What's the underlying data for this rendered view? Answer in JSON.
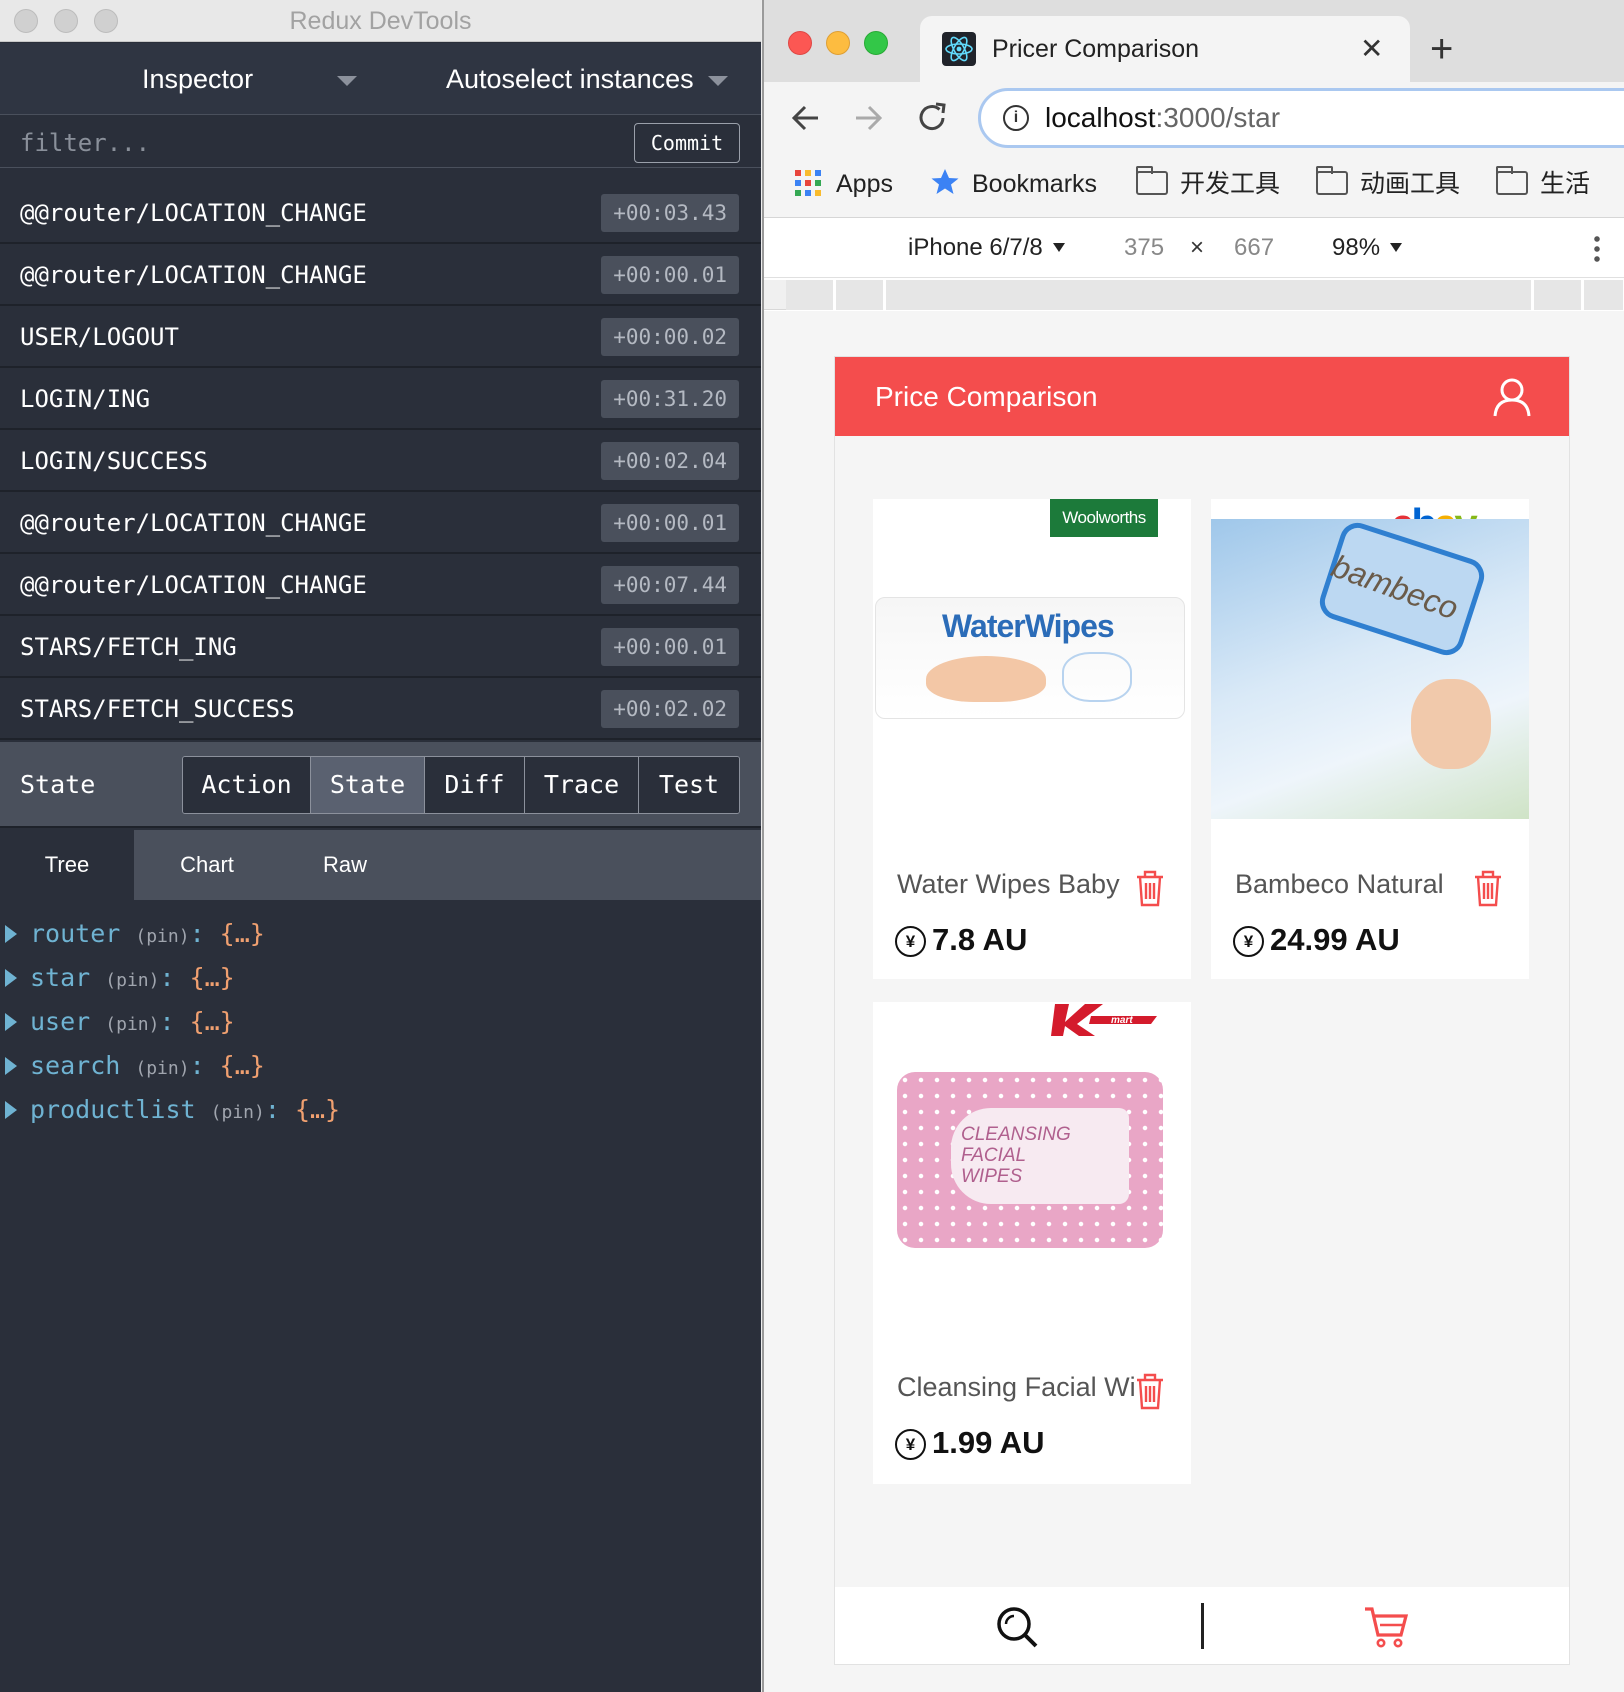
{
  "devtools": {
    "window_title": "Redux DevTools",
    "monitor_label": "Inspector",
    "instances_label": "Autoselect instances",
    "filter_placeholder": "filter...",
    "commit_label": "Commit",
    "actions": [
      {
        "name": "@@router/LOCATION_CHANGE",
        "time": "+00:03.43"
      },
      {
        "name": "@@router/LOCATION_CHANGE",
        "time": "+00:00.01"
      },
      {
        "name": "USER/LOGOUT",
        "time": "+00:00.02"
      },
      {
        "name": "LOGIN/ING",
        "time": "+00:31.20"
      },
      {
        "name": "LOGIN/SUCCESS",
        "time": "+00:02.04"
      },
      {
        "name": "@@router/LOCATION_CHANGE",
        "time": "+00:00.01"
      },
      {
        "name": "@@router/LOCATION_CHANGE",
        "time": "+00:07.44"
      },
      {
        "name": "STARS/FETCH_ING",
        "time": "+00:00.01"
      },
      {
        "name": "STARS/FETCH_SUCCESS",
        "time": "+00:02.02"
      }
    ],
    "state_bar_title": "State",
    "tabs": [
      "Action",
      "State",
      "Diff",
      "Trace",
      "Test"
    ],
    "active_tab": "State",
    "subtabs": [
      "Tree",
      "Chart",
      "Raw"
    ],
    "active_subtab": "Tree",
    "tree": [
      {
        "key": "router",
        "pin": "(pin)",
        "value": "{…}"
      },
      {
        "key": "star",
        "pin": "(pin)",
        "value": "{…}"
      },
      {
        "key": "user",
        "pin": "(pin)",
        "value": "{…}"
      },
      {
        "key": "search",
        "pin": "(pin)",
        "value": "{…}"
      },
      {
        "key": "productlist",
        "pin": "(pin)",
        "value": "{…}"
      }
    ]
  },
  "browser": {
    "tab_title": "Pricer Comparison",
    "tab_close": "✕",
    "new_tab": "+",
    "url_host": "localhost",
    "url_path": ":3000/star",
    "bookmarks": {
      "apps": "Apps",
      "bookmarks": "Bookmarks",
      "folders": [
        "开发工具",
        "动画工具",
        "生活"
      ]
    },
    "device": {
      "name": "iPhone 6/7/8",
      "width": "375",
      "times": "×",
      "height": "667",
      "zoom": "98%"
    }
  },
  "app": {
    "title": "Price Comparison",
    "products": [
      {
        "name": "Water Wipes Baby",
        "price": "7.8 AU",
        "currency_symbol": "¥",
        "store": "Woolworths",
        "store_logo_text": "Woolworths",
        "package_text": "WaterWipes"
      },
      {
        "name": "Bambeco Natural",
        "price": "24.99 AU",
        "currency_symbol": "¥",
        "store": "ebay",
        "package_text": "bambeco"
      },
      {
        "name": "Cleansing Facial Wi",
        "price": "1.99 AU",
        "currency_symbol": "¥",
        "store": "Kmart",
        "package_text": "CLEANSING FACIAL WIPES"
      }
    ],
    "footer_icons": [
      "search-icon",
      "cart-icon"
    ]
  },
  "colors": {
    "devtools_bg": "#2a2f3a",
    "accent_red": "#f44d4d",
    "tree_key": "#6fb3d2",
    "tree_value": "#f0a070"
  }
}
